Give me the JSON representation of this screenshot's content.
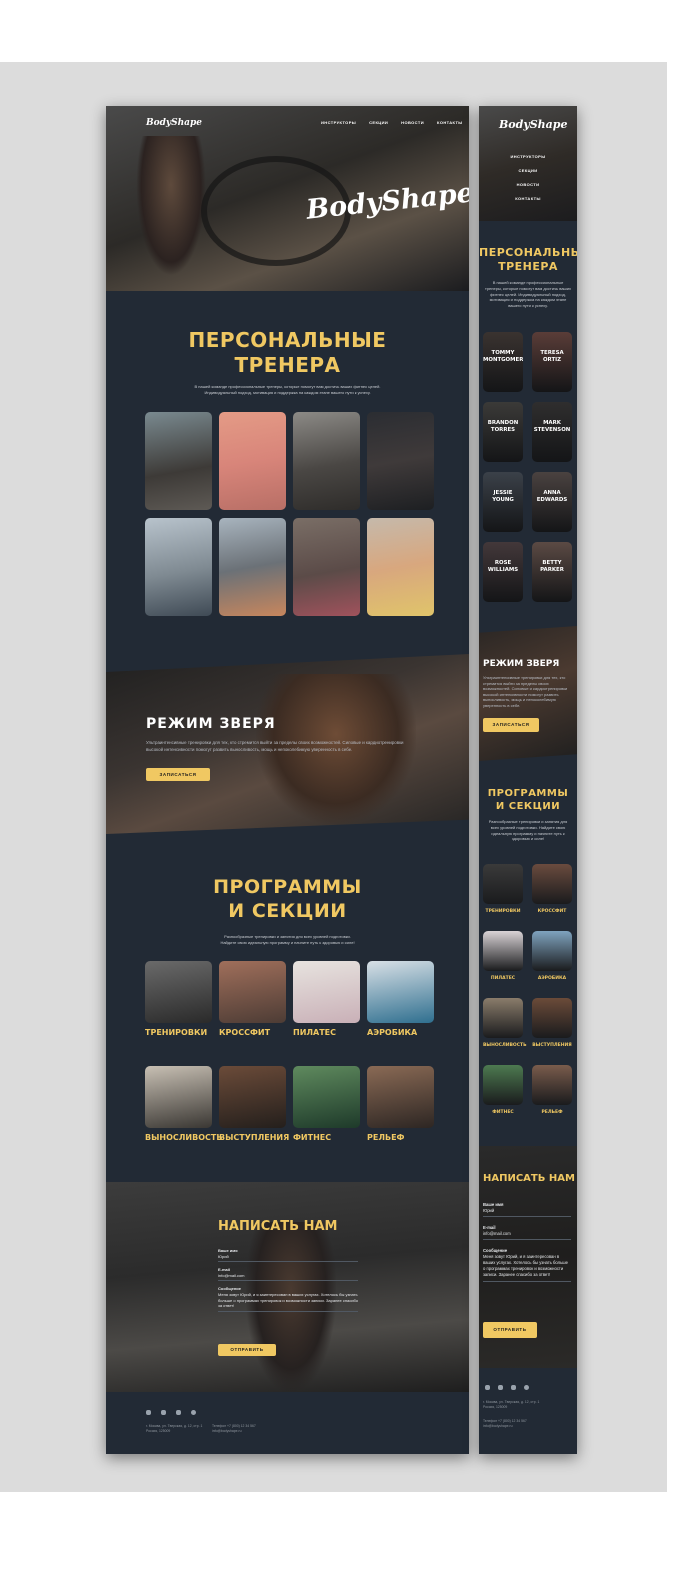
{
  "brand": {
    "logo": "BodyShape"
  },
  "nav": {
    "items": [
      "ИНСТРУКТОРЫ",
      "СЕКЦИИ",
      "НОВОСТИ",
      "КОНТАКТЫ"
    ]
  },
  "trainers": {
    "title_line1": "ПЕРСОНАЛЬНЫЕ",
    "title_line2": "ТРЕНЕРА",
    "desc_desktop_1": "В нашей команде профессиональные тренеры, которые помогут вам достичь ваших фитнес целей.",
    "desc_desktop_2": "Индивидуальный подход, мотивация и поддержка на каждом этапе вашего пути к успеху.",
    "desc_mobile": "В нашей команде профессиональные тренеры, которые помогут вам достичь ваших фитнес целей. Индивидуальный подход, мотивация и поддержка на каждом этапе вашего пути к успеху.",
    "people": [
      {
        "line1": "TOMMY",
        "line2": "MONTGOMERY"
      },
      {
        "line1": "TERESA",
        "line2": "ORTIZ"
      },
      {
        "line1": "BRANDON",
        "line2": "TORRES"
      },
      {
        "line1": "MARK",
        "line2": "STEVENSON"
      },
      {
        "line1": "JESSIE",
        "line2": "YOUNG"
      },
      {
        "line1": "ANNA",
        "line2": "EDWARDS"
      },
      {
        "line1": "ROSE",
        "line2": "WILLIAMS"
      },
      {
        "line1": "BETTY",
        "line2": "PARKER"
      }
    ]
  },
  "beast": {
    "title": "РЕЖИМ ЗВЕРЯ",
    "desc": "Ультраинтенсивные тренировки для тех, кто стремится выйти за пределы своих возможностей. Силовые и кардиотренировки высокой интенсивности помогут развить выносливость, мощь и непоколебимую уверенность в себе.",
    "button": "ЗАПИСАТЬСЯ"
  },
  "programs": {
    "title_line1": "ПРОГРАММЫ",
    "title_line2": "И СЕКЦИИ",
    "desc_desktop_1": "Разнообразные тренировки и занятия для всех уровней подготовки.",
    "desc_desktop_2": "Найдите свою идеальную программу и начните путь к здоровью и силе!",
    "desc_mobile": "Разнообразные тренировки и занятия для всех уровней подготовки. Найдите свою идеальную программу и начните путь к здоровью и силе!",
    "items": [
      "ТРЕНИРОВКИ",
      "КРОССФИТ",
      "ПИЛАТЕС",
      "АЭРОБИКА",
      "ВЫНОСЛИВОСТЬ",
      "ВЫСТУПЛЕНИЯ",
      "ФИТНЕС",
      "РЕЛЬЕФ"
    ]
  },
  "contact": {
    "title": "НАПИСАТЬ НАМ",
    "name_label": "Ваше имя",
    "name_value": "Юрий",
    "email_label": "E-mail",
    "email_value": "info@mail.com",
    "msg_label": "Сообщение",
    "msg_value": "Меня зовут Юрий, и я заинтересован в ваших услугах. Хотелось бы узнать больше о программах тренировок и возможности записи. Заранее спасибо за ответ!",
    "button": "ОТПРАВИТЬ"
  },
  "footer": {
    "address": "г. Москва, ул. Тверская, д. 12, стр. 1",
    "city": "Россия, 125009",
    "phone": "Телефон +7 (800) 12 34 567",
    "email": "info@bodyshape.ru",
    "icons": [
      "vk-icon",
      "mail-icon",
      "ok-icon",
      "telegram-icon"
    ]
  },
  "colors": {
    "accent": "#f0c862",
    "background": "#222a35",
    "page": "#dcdcdc"
  }
}
